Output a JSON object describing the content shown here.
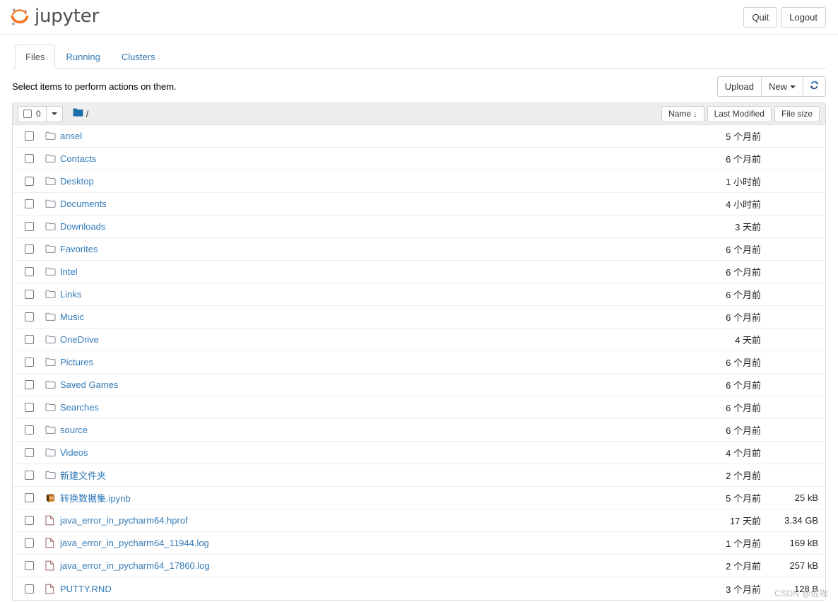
{
  "header": {
    "brand": "jupyter",
    "logo_icon": "jupyter-logo-icon",
    "quit_label": "Quit",
    "logout_label": "Logout"
  },
  "tabs": [
    {
      "label": "Files",
      "active": true
    },
    {
      "label": "Running",
      "active": false
    },
    {
      "label": "Clusters",
      "active": false
    }
  ],
  "actions": {
    "hint": "Select items to perform actions on them.",
    "upload_label": "Upload",
    "new_label": "New",
    "refresh_icon": "refresh-icon"
  },
  "list_toolbar": {
    "selected_count": "0",
    "select_all_icon": "checkbox-icon",
    "dropdown_icon": "chevron-down-icon",
    "breadcrumb_icon": "folder-solid-icon",
    "breadcrumb_path": "/",
    "sort_name": "Name",
    "sort_name_arrow": "↓",
    "sort_modified": "Last Modified",
    "sort_size": "File size"
  },
  "colors": {
    "link": "#337ab7",
    "brand_orange": "#f37726",
    "tab_active_text": "#555555",
    "panel_border": "#dddddd",
    "toolbar_bg": "#eeeeee"
  },
  "files": [
    {
      "name": "ansel",
      "type": "folder",
      "icon": "folder-icon",
      "modified": "5 个月前",
      "size": ""
    },
    {
      "name": "Contacts",
      "type": "folder",
      "icon": "folder-icon",
      "modified": "6 个月前",
      "size": ""
    },
    {
      "name": "Desktop",
      "type": "folder",
      "icon": "folder-icon",
      "modified": "1 小时前",
      "size": ""
    },
    {
      "name": "Documents",
      "type": "folder",
      "icon": "folder-icon",
      "modified": "4 小时前",
      "size": ""
    },
    {
      "name": "Downloads",
      "type": "folder",
      "icon": "folder-icon",
      "modified": "3 天前",
      "size": ""
    },
    {
      "name": "Favorites",
      "type": "folder",
      "icon": "folder-icon",
      "modified": "6 个月前",
      "size": ""
    },
    {
      "name": "Intel",
      "type": "folder",
      "icon": "folder-icon",
      "modified": "6 个月前",
      "size": ""
    },
    {
      "name": "Links",
      "type": "folder",
      "icon": "folder-icon",
      "modified": "6 个月前",
      "size": ""
    },
    {
      "name": "Music",
      "type": "folder",
      "icon": "folder-icon",
      "modified": "6 个月前",
      "size": ""
    },
    {
      "name": "OneDrive",
      "type": "folder",
      "icon": "folder-icon",
      "modified": "4 天前",
      "size": ""
    },
    {
      "name": "Pictures",
      "type": "folder",
      "icon": "folder-icon",
      "modified": "6 个月前",
      "size": ""
    },
    {
      "name": "Saved Games",
      "type": "folder",
      "icon": "folder-icon",
      "modified": "6 个月前",
      "size": ""
    },
    {
      "name": "Searches",
      "type": "folder",
      "icon": "folder-icon",
      "modified": "6 个月前",
      "size": ""
    },
    {
      "name": "source",
      "type": "folder",
      "icon": "folder-icon",
      "modified": "6 个月前",
      "size": ""
    },
    {
      "name": "Videos",
      "type": "folder",
      "icon": "folder-icon",
      "modified": "4 个月前",
      "size": ""
    },
    {
      "name": "新建文件夹",
      "type": "folder",
      "icon": "folder-icon",
      "modified": "2 个月前",
      "size": ""
    },
    {
      "name": "转换数据集.ipynb",
      "type": "notebook",
      "icon": "notebook-icon",
      "modified": "5 个月前",
      "size": "25 kB"
    },
    {
      "name": "java_error_in_pycharm64.hprof",
      "type": "file",
      "icon": "file-icon",
      "modified": "17 天前",
      "size": "3.34 GB"
    },
    {
      "name": "java_error_in_pycharm64_11944.log",
      "type": "file",
      "icon": "file-icon",
      "modified": "1 个月前",
      "size": "169 kB"
    },
    {
      "name": "java_error_in_pycharm64_17860.log",
      "type": "file",
      "icon": "file-icon",
      "modified": "2 个月前",
      "size": "257 kB"
    },
    {
      "name": "PUTTY.RND",
      "type": "file",
      "icon": "file-icon",
      "modified": "3 个月前",
      "size": "128 B"
    }
  ],
  "watermark": {
    "text": "CSDN @佐咖"
  }
}
